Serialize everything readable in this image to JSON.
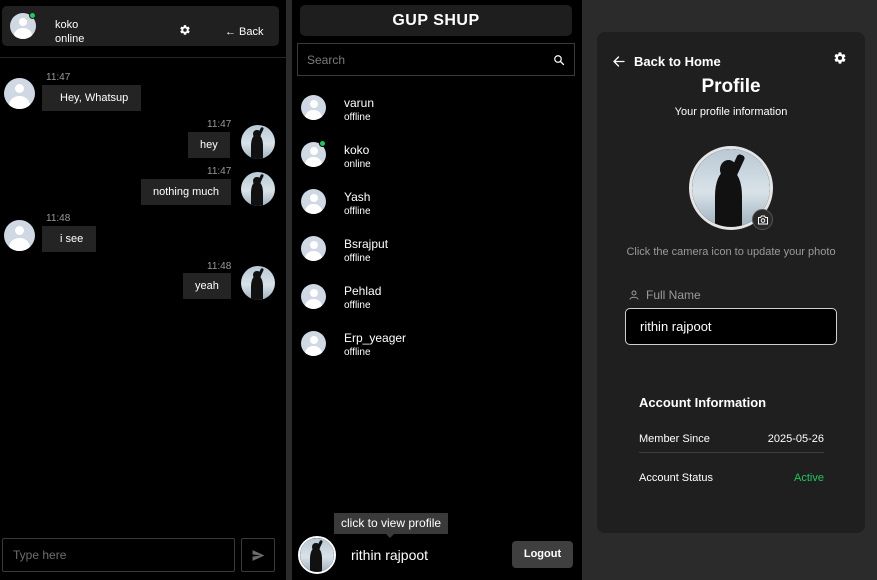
{
  "chat": {
    "contact_name": "koko",
    "contact_status": "online",
    "back_label": "← Back",
    "input_placeholder": "Type here",
    "messages": [
      {
        "time": "11:47",
        "text": "Hey, Whatsup",
        "side": "left"
      },
      {
        "time": "11:47",
        "text": "hey",
        "side": "right"
      },
      {
        "time": "11:47",
        "text": "nothing much",
        "side": "right"
      },
      {
        "time": "11:48",
        "text": "i see",
        "side": "left"
      },
      {
        "time": "11:48",
        "text": "yeah",
        "side": "right"
      }
    ]
  },
  "contacts": {
    "app_title": "GUP SHUP",
    "search_placeholder": "Search",
    "list": [
      {
        "name": "varun",
        "status": "offline"
      },
      {
        "name": "koko",
        "status": "online"
      },
      {
        "name": "Yash",
        "status": "offline"
      },
      {
        "name": "Bsrajput",
        "status": "offline"
      },
      {
        "name": "Pehlad",
        "status": "offline"
      },
      {
        "name": "Erp_yeager",
        "status": "offline"
      }
    ],
    "tooltip": "click to view profile",
    "current_user": "rithin rajpoot",
    "logout_label": "Logout"
  },
  "profile": {
    "back_label": "Back to Home",
    "title": "Profile",
    "subtitle": "Your profile information",
    "photo_hint": "Click the camera icon to update your photo",
    "full_name_label": "Full Name",
    "full_name_value": "rithin rajpoot",
    "account_title": "Account Information",
    "member_since_label": "Member Since",
    "member_since_value": "2025-05-26",
    "account_status_label": "Account Status",
    "account_status_value": "Active"
  },
  "colors": {
    "online": "#22c55e",
    "active": "#22c55e",
    "bubble": "#242424",
    "panel": "#1f1f1f"
  }
}
